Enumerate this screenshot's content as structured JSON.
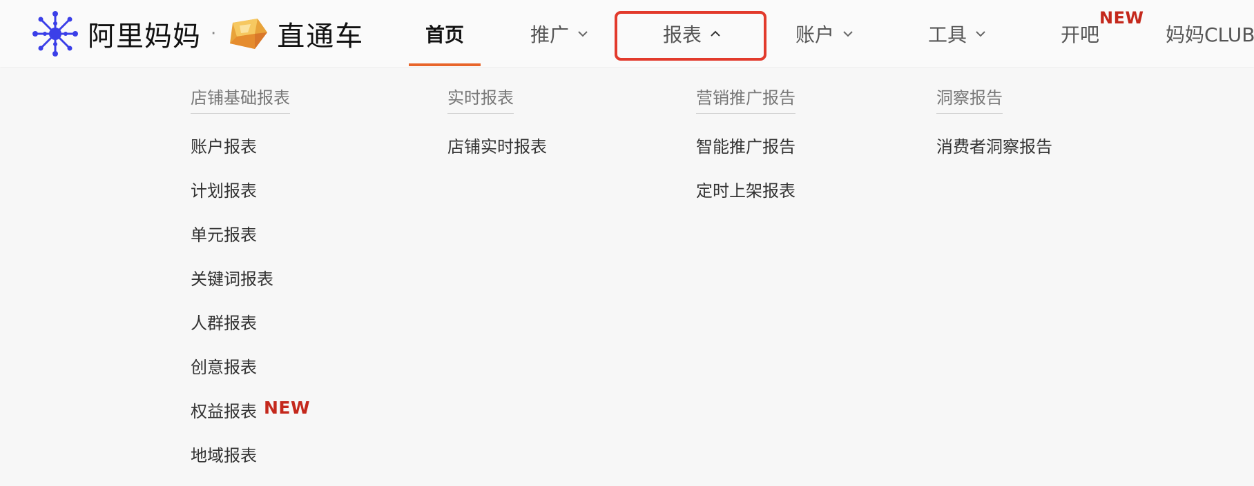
{
  "brand": {
    "alimama": "阿里妈妈",
    "separator": "·",
    "product": "直通车"
  },
  "nav": {
    "home": "首页",
    "promote": "推广",
    "reports": "报表",
    "account": "账户",
    "tools": "工具",
    "kaiba": "开吧",
    "kaiba_badge": "NEW",
    "club": "妈妈CLUB"
  },
  "menu": {
    "col1": {
      "title": "店铺基础报表",
      "items": [
        "账户报表",
        "计划报表",
        "单元报表",
        "关键词报表",
        "人群报表",
        "创意报表",
        "权益报表",
        "地域报表"
      ],
      "new_badge": "NEW"
    },
    "col2": {
      "title": "实时报表",
      "items": [
        "店铺实时报表"
      ]
    },
    "col3": {
      "title": "营销推广报告",
      "items": [
        "智能推广报告",
        "定时上架报表"
      ]
    },
    "col4": {
      "title": "洞察报告",
      "items": [
        "消费者洞察报告"
      ]
    }
  },
  "colors": {
    "accent": "#e8652a",
    "highlight": "#e23a2c",
    "new_badge": "#c4281c",
    "alimama_blue": "#3b3fe8"
  },
  "icons": {
    "alimama": "alimama-logo-icon",
    "ztc": "zhitongche-logo-icon",
    "chevron_down": "chevron-down-icon",
    "chevron_up": "chevron-up-icon"
  }
}
